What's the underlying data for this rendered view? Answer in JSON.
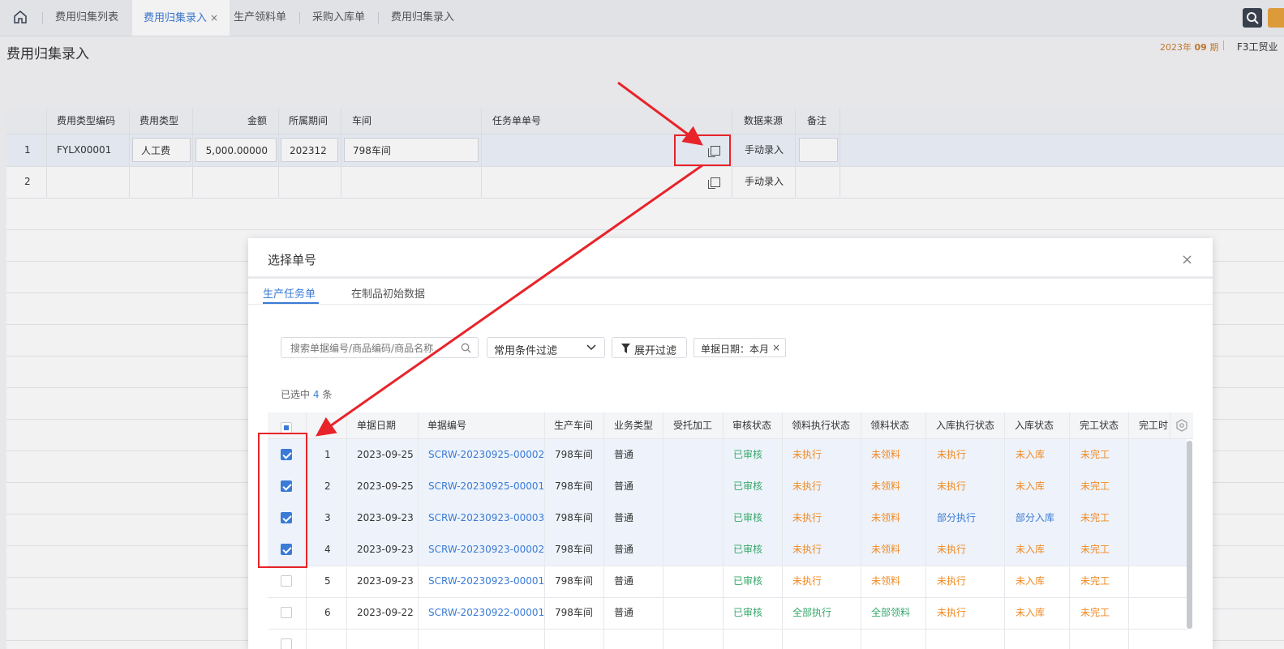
{
  "topbar": {
    "tabs": [
      {
        "label": "费用归集列表",
        "active": false
      },
      {
        "label": "费用归集录入",
        "active": true,
        "closable": true
      },
      {
        "label": "生产领料单",
        "active": false
      },
      {
        "label": "采购入库单",
        "active": false
      },
      {
        "label": "费用归集录入",
        "active": false
      }
    ],
    "close_glyph": "×",
    "icons": {
      "home": "home-icon",
      "search": "search-icon"
    }
  },
  "header": {
    "title": "费用归集录入",
    "period_year": "2023年",
    "period_num": "09",
    "period_unit": "期",
    "company": "F3工贸业"
  },
  "background_grid": {
    "columns": [
      "费用类型编码",
      "费用类型",
      "金额",
      "所属期间",
      "车间",
      "任务单单号",
      "数据来源",
      "备注"
    ],
    "rows": [
      {
        "no": "1",
        "code": "FYLX00001",
        "type": "人工费",
        "amount": "5,000.00000",
        "period": "202312",
        "workshop": "798车间",
        "task_no": "",
        "source": "手动录入",
        "remark": ""
      },
      {
        "no": "2",
        "code": "",
        "type": "",
        "amount": "",
        "period": "",
        "workshop": "",
        "task_no": "",
        "source": "手动录入",
        "remark": ""
      }
    ]
  },
  "modal": {
    "title": "选择单号",
    "close_glyph": "×",
    "tabs": [
      {
        "label": "生产任务单",
        "active": true
      },
      {
        "label": "在制品初始数据",
        "active": false
      }
    ],
    "search": {
      "placeholder": "搜索单据编号/商品编码/商品名称"
    },
    "filter_select": {
      "value": "常用条件过滤"
    },
    "expand_button": {
      "label": "展开过滤"
    },
    "filter_tag": {
      "label": "单据日期：本月",
      "close_glyph": "×"
    },
    "selected": {
      "prefix": "已选中",
      "count": "4",
      "suffix": "条"
    },
    "table": {
      "headers": [
        "单据日期",
        "单据编号",
        "生产车间",
        "业务类型",
        "受托加工",
        "审核状态",
        "领料执行状态",
        "领料状态",
        "入库执行状态",
        "入库状态",
        "完工状态",
        "完工时"
      ],
      "rows": [
        {
          "checked": true,
          "no": "1",
          "date": "2023-09-25",
          "doc_no": "SCRW-20230925-00002",
          "workshop": "798车间",
          "biz_type": "普通",
          "outsourced": "",
          "audit": "已审核",
          "pick_exec": "未执行",
          "pick": "未领料",
          "stock_exec": "未执行",
          "stock": "未入库",
          "finish": "未完工"
        },
        {
          "checked": true,
          "no": "2",
          "date": "2023-09-25",
          "doc_no": "SCRW-20230925-00001",
          "workshop": "798车间",
          "biz_type": "普通",
          "outsourced": "",
          "audit": "已审核",
          "pick_exec": "未执行",
          "pick": "未领料",
          "stock_exec": "未执行",
          "stock": "未入库",
          "finish": "未完工"
        },
        {
          "checked": true,
          "no": "3",
          "date": "2023-09-23",
          "doc_no": "SCRW-20230923-00003",
          "workshop": "798车间",
          "biz_type": "普通",
          "outsourced": "",
          "audit": "已审核",
          "pick_exec": "未执行",
          "pick": "未领料",
          "stock_exec": "部分执行",
          "stock": "部分入库",
          "finish": "未完工"
        },
        {
          "checked": true,
          "no": "4",
          "date": "2023-09-23",
          "doc_no": "SCRW-20230923-00002",
          "workshop": "798车间",
          "biz_type": "普通",
          "outsourced": "",
          "audit": "已审核",
          "pick_exec": "未执行",
          "pick": "未领料",
          "stock_exec": "未执行",
          "stock": "未入库",
          "finish": "未完工"
        },
        {
          "checked": false,
          "no": "5",
          "date": "2023-09-23",
          "doc_no": "SCRW-20230923-00001",
          "workshop": "798车间",
          "biz_type": "普通",
          "outsourced": "",
          "audit": "已审核",
          "pick_exec": "未执行",
          "pick": "未领料",
          "stock_exec": "未执行",
          "stock": "未入库",
          "finish": "未完工"
        },
        {
          "checked": false,
          "no": "6",
          "date": "2023-09-22",
          "doc_no": "SCRW-20230922-00001",
          "workshop": "798车间",
          "biz_type": "普通",
          "outsourced": "",
          "audit": "已审核",
          "pick_exec": "全部执行",
          "pick": "全部领料",
          "stock_exec": "未执行",
          "stock": "未入库",
          "finish": "未完工"
        }
      ]
    }
  },
  "colors": {
    "accent": "#3a7bd5",
    "status_green": "#36a86a",
    "status_orange": "#f08a24",
    "annotation_red": "#e8232a"
  }
}
